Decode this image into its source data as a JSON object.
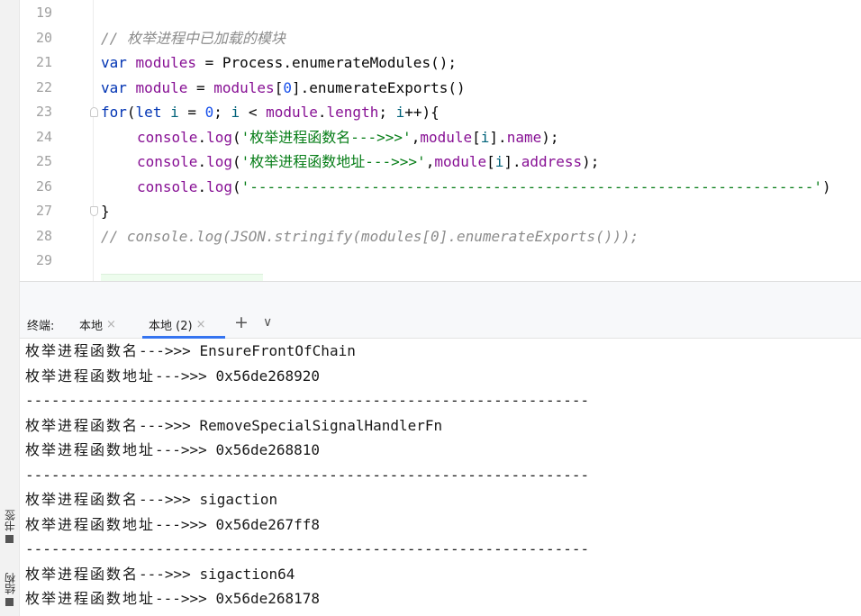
{
  "editor": {
    "lines": [
      {
        "num": "19",
        "tokens": []
      },
      {
        "num": "20",
        "tokens": [
          {
            "t": "// 枚举进程中已加载的模块",
            "c": "comment"
          }
        ]
      },
      {
        "num": "21",
        "tokens": [
          {
            "t": "var",
            "c": "kw"
          },
          {
            "t": " ",
            "c": ""
          },
          {
            "t": "modules",
            "c": "var"
          },
          {
            "t": " = Process.enumerateModules();",
            "c": ""
          }
        ]
      },
      {
        "num": "22",
        "tokens": [
          {
            "t": "var",
            "c": "kw"
          },
          {
            "t": " ",
            "c": ""
          },
          {
            "t": "module",
            "c": "var"
          },
          {
            "t": " = ",
            "c": ""
          },
          {
            "t": "modules",
            "c": "var"
          },
          {
            "t": "[",
            "c": ""
          },
          {
            "t": "0",
            "c": "num"
          },
          {
            "t": "].enumerateExports()",
            "c": ""
          }
        ]
      },
      {
        "num": "23",
        "fold": "up",
        "tokens": [
          {
            "t": "for",
            "c": "kw"
          },
          {
            "t": "(",
            "c": ""
          },
          {
            "t": "let",
            "c": "kw"
          },
          {
            "t": " ",
            "c": ""
          },
          {
            "t": "i",
            "c": "idx"
          },
          {
            "t": " = ",
            "c": ""
          },
          {
            "t": "0",
            "c": "num"
          },
          {
            "t": "; ",
            "c": ""
          },
          {
            "t": "i",
            "c": "idx"
          },
          {
            "t": " < ",
            "c": ""
          },
          {
            "t": "module",
            "c": "var"
          },
          {
            "t": ".",
            "c": ""
          },
          {
            "t": "length",
            "c": "prop"
          },
          {
            "t": "; ",
            "c": ""
          },
          {
            "t": "i",
            "c": "idx"
          },
          {
            "t": "++){",
            "c": ""
          }
        ]
      },
      {
        "num": "24",
        "indent": true,
        "tokens": [
          {
            "t": "console",
            "c": "var"
          },
          {
            "t": ".",
            "c": ""
          },
          {
            "t": "log",
            "c": "func"
          },
          {
            "t": "(",
            "c": ""
          },
          {
            "t": "'枚举进程函数名--->>>'",
            "c": "str"
          },
          {
            "t": ",",
            "c": ""
          },
          {
            "t": "module",
            "c": "var"
          },
          {
            "t": "[",
            "c": ""
          },
          {
            "t": "i",
            "c": "idx"
          },
          {
            "t": "].",
            "c": ""
          },
          {
            "t": "name",
            "c": "prop"
          },
          {
            "t": ");",
            "c": ""
          }
        ]
      },
      {
        "num": "25",
        "indent": true,
        "tokens": [
          {
            "t": "console",
            "c": "var"
          },
          {
            "t": ".",
            "c": ""
          },
          {
            "t": "log",
            "c": "func"
          },
          {
            "t": "(",
            "c": ""
          },
          {
            "t": "'枚举进程函数地址--->>>'",
            "c": "str"
          },
          {
            "t": ",",
            "c": ""
          },
          {
            "t": "module",
            "c": "var"
          },
          {
            "t": "[",
            "c": ""
          },
          {
            "t": "i",
            "c": "idx"
          },
          {
            "t": "].",
            "c": ""
          },
          {
            "t": "address",
            "c": "prop"
          },
          {
            "t": ");",
            "c": ""
          }
        ]
      },
      {
        "num": "26",
        "indent": true,
        "tokens": [
          {
            "t": "console",
            "c": "var"
          },
          {
            "t": ".",
            "c": ""
          },
          {
            "t": "log",
            "c": "func"
          },
          {
            "t": "(",
            "c": ""
          },
          {
            "t": "'-----------------------------------------------------------------'",
            "c": "str"
          },
          {
            "t": ")",
            "c": ""
          }
        ]
      },
      {
        "num": "27",
        "fold": "down",
        "tokens": [
          {
            "t": "}",
            "c": ""
          }
        ]
      },
      {
        "num": "28",
        "tokens": [
          {
            "t": "// console.log(JSON.stringify(modules[0].enumerateExports()));",
            "c": "comment"
          }
        ]
      },
      {
        "num": "29",
        "tokens": []
      }
    ]
  },
  "terminal": {
    "label": "终端:",
    "tabs": [
      {
        "label": "本地",
        "close": "×"
      },
      {
        "label": "本地 (2)",
        "close": "×"
      }
    ],
    "add_icon": "+",
    "menu_icon": "∨",
    "output": [
      {
        "prefix": "枚举进程函数名",
        "rest": "--->>> EnsureFrontOfChain"
      },
      {
        "prefix": "枚举进程函数地址",
        "rest": "--->>> 0x56de268920"
      },
      {
        "prefix": "",
        "rest": "-----------------------------------------------------------------"
      },
      {
        "prefix": "枚举进程函数名",
        "rest": "--->>> RemoveSpecialSignalHandlerFn"
      },
      {
        "prefix": "枚举进程函数地址",
        "rest": "--->>> 0x56de268810"
      },
      {
        "prefix": "",
        "rest": "-----------------------------------------------------------------"
      },
      {
        "prefix": "枚举进程函数名",
        "rest": "--->>> sigaction"
      },
      {
        "prefix": "枚举进程函数地址",
        "rest": "--->>> 0x56de267ff8"
      },
      {
        "prefix": "",
        "rest": "-----------------------------------------------------------------"
      },
      {
        "prefix": "枚举进程函数名",
        "rest": "--->>> sigaction64"
      },
      {
        "prefix": "枚举进程函数地址",
        "rest": "--->>> 0x56de268178"
      }
    ]
  },
  "side_tabs": {
    "bookmarks": "书签",
    "structure": "结构"
  }
}
